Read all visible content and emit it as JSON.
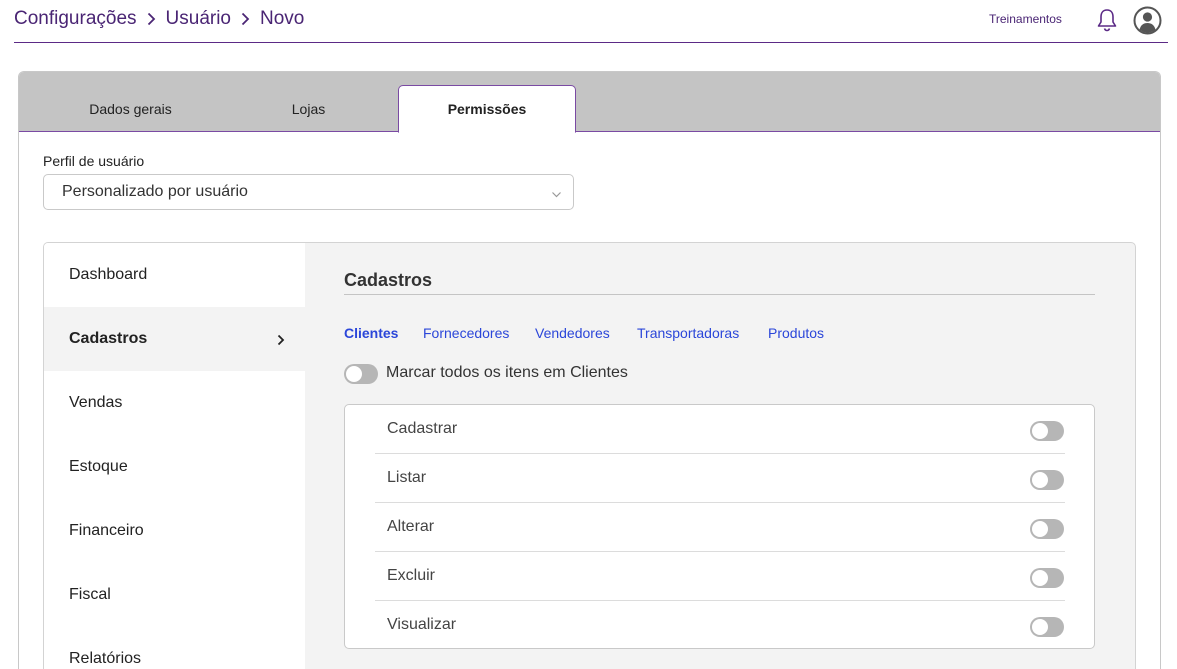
{
  "breadcrumb": [
    "Configurações",
    "Usuário",
    "Novo"
  ],
  "header": {
    "training_label": "Treinamentos",
    "icons": [
      "bell-icon",
      "user-avatar-icon"
    ]
  },
  "tabs": [
    {
      "label": "Dados gerais",
      "active": false
    },
    {
      "label": "Lojas",
      "active": false
    },
    {
      "label": "Permissões",
      "active": true
    }
  ],
  "profile": {
    "label": "Perfil de usuário",
    "value": "Personalizado por usuário"
  },
  "menu": [
    {
      "label": "Dashboard",
      "active": false
    },
    {
      "label": "Cadastros",
      "active": true
    },
    {
      "label": "Vendas",
      "active": false
    },
    {
      "label": "Estoque",
      "active": false
    },
    {
      "label": "Financeiro",
      "active": false
    },
    {
      "label": "Fiscal",
      "active": false
    },
    {
      "label": "Relatórios",
      "active": false
    }
  ],
  "section": {
    "title": "Cadastros",
    "subtabs": [
      {
        "label": "Clientes",
        "active": true
      },
      {
        "label": "Fornecedores",
        "active": false
      },
      {
        "label": "Vendedores",
        "active": false
      },
      {
        "label": "Transportadoras",
        "active": false
      },
      {
        "label": "Produtos",
        "active": false
      }
    ],
    "mark_all": {
      "label": "Marcar todos os itens em Clientes",
      "enabled": false
    },
    "permissions": [
      {
        "label": "Cadastrar",
        "enabled": false
      },
      {
        "label": "Listar",
        "enabled": false
      },
      {
        "label": "Alterar",
        "enabled": false
      },
      {
        "label": "Excluir",
        "enabled": false
      },
      {
        "label": "Visualizar",
        "enabled": false
      }
    ]
  },
  "colors": {
    "brand": "#4a2574",
    "link": "#2b46d9",
    "tab_bar": "#c4c4c4",
    "toggle_off": "#b6b6b6"
  }
}
